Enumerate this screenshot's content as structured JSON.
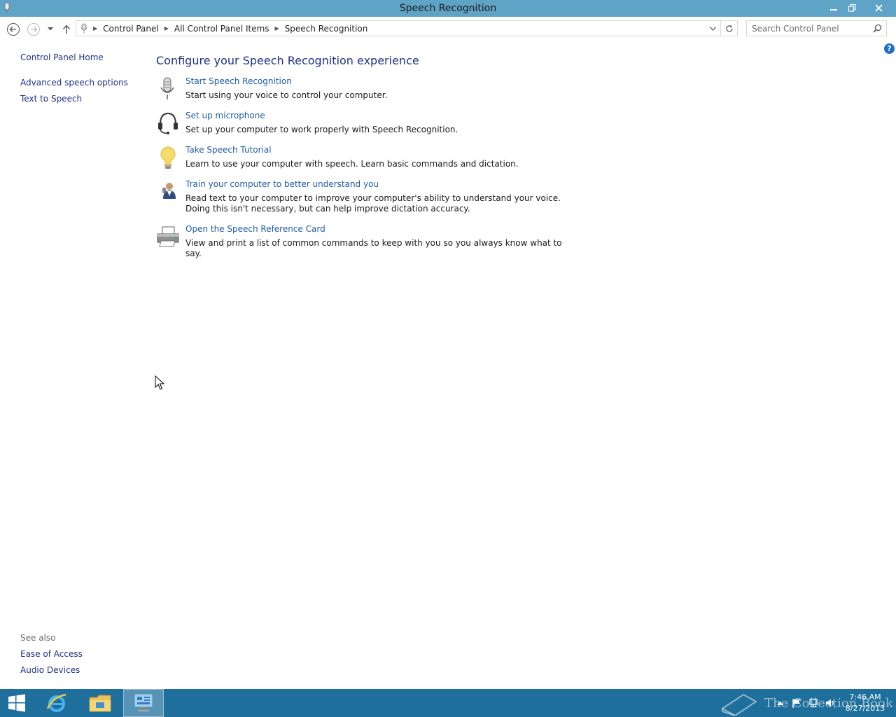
{
  "window": {
    "title": "Speech Recognition"
  },
  "breadcrumb": [
    {
      "label": "Control Panel"
    },
    {
      "label": "All Control Panel Items"
    },
    {
      "label": "Speech Recognition"
    }
  ],
  "search": {
    "placeholder": "Search Control Panel"
  },
  "sidebar": {
    "home": "Control Panel Home",
    "items": [
      {
        "label": "Advanced speech options"
      },
      {
        "label": "Text to Speech"
      }
    ],
    "see_also_heading": "See also",
    "see_also": [
      {
        "label": "Ease of Access"
      },
      {
        "label": "Audio Devices"
      }
    ]
  },
  "main": {
    "heading": "Configure your Speech Recognition experience",
    "tasks": [
      {
        "link": "Start Speech Recognition",
        "desc": "Start using your voice to control your computer.",
        "icon": "microphone-icon"
      },
      {
        "link": "Set up microphone",
        "desc": "Set up your computer to work properly with Speech Recognition.",
        "icon": "headset-icon"
      },
      {
        "link": "Take Speech Tutorial",
        "desc": "Learn to use your computer with speech.  Learn basic commands and dictation.",
        "icon": "lightbulb-icon"
      },
      {
        "link": "Train your computer to better understand you",
        "desc": "Read text to your computer to improve your computer's ability to understand your voice.  Doing this isn't necessary, but can help improve dictation accuracy.",
        "icon": "user-speech-icon"
      },
      {
        "link": "Open the Speech Reference Card",
        "desc": "View and print a list of common commands to keep with you so you always know what to say.",
        "icon": "printer-icon"
      }
    ]
  },
  "taskbar": {
    "time": "7:46 AM",
    "date": "8/27/2013",
    "watermark": "The Collection Book"
  },
  "colors": {
    "titlebar": "#5fa3c6",
    "taskbar": "#1f6f9d",
    "link": "#1e5da8",
    "heading": "#1e3287"
  }
}
